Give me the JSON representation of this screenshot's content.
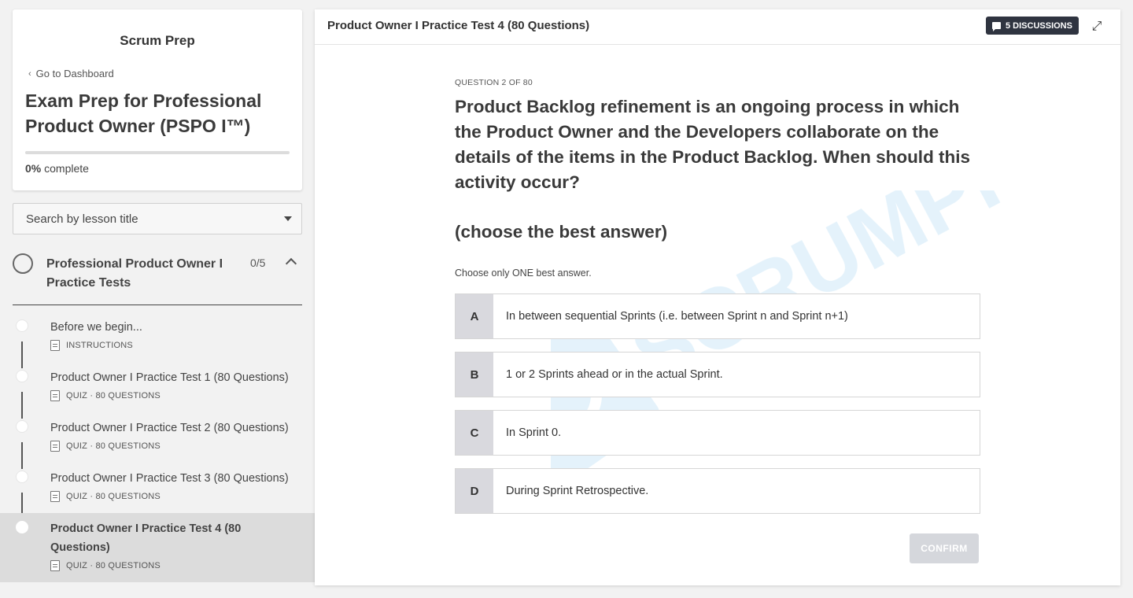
{
  "sidebar": {
    "school_name": "Scrum Prep",
    "back_link": "Go to Dashboard",
    "course_title": "Exam Prep for Professional Product Owner (PSPO I™)",
    "progress_percent": 0,
    "progress_value": "0%",
    "progress_suffix": " complete",
    "search_placeholder": "Search by lesson title",
    "chapter": {
      "title": "Professional Product Owner I Practice Tests",
      "count": "0/5"
    },
    "lessons": [
      {
        "title": "Before we begin...",
        "meta": "INSTRUCTIONS"
      },
      {
        "title": "Product Owner I Practice Test 1 (80 Questions)",
        "meta": "QUIZ · 80 QUESTIONS"
      },
      {
        "title": "Product Owner I Practice Test 2 (80 Questions)",
        "meta": "QUIZ · 80 QUESTIONS"
      },
      {
        "title": "Product Owner I Practice Test 3 (80 Questions)",
        "meta": "QUIZ · 80 QUESTIONS"
      },
      {
        "title": "Product Owner I Practice Test 4 (80 Questions)",
        "meta": "QUIZ · 80 QUESTIONS"
      }
    ]
  },
  "main": {
    "title": "Product Owner I Practice Test 4 (80 Questions)",
    "discussions_label": "5 DISCUSSIONS",
    "watermark": "SCRUMPREP",
    "question": {
      "label": "QUESTION 2 OF 80",
      "text": "Product Backlog refinement is an ongoing process in which the Product Owner and the Developers collaborate on the details of the items in the Product Backlog. When should this activity occur?",
      "hint": "(choose the best answer)",
      "instruction": "Choose only ONE best answer.",
      "options": [
        {
          "letter": "A",
          "text": "In between sequential Sprints (i.e. between Sprint n and Sprint n+1)"
        },
        {
          "letter": "B",
          "text": "1 or 2 Sprints ahead or in the actual Sprint."
        },
        {
          "letter": "C",
          "text": "In Sprint 0."
        },
        {
          "letter": "D",
          "text": "During Sprint Retrospective."
        }
      ]
    },
    "confirm_label": "CONFIRM"
  },
  "colors": {
    "accent_dark": "#2f3440",
    "option_letter_bg": "#d9d9de",
    "confirm_disabled": "#d5d7dc",
    "active_lesson_bg": "#dcdcdc",
    "watermark": "#3aa3e0"
  }
}
